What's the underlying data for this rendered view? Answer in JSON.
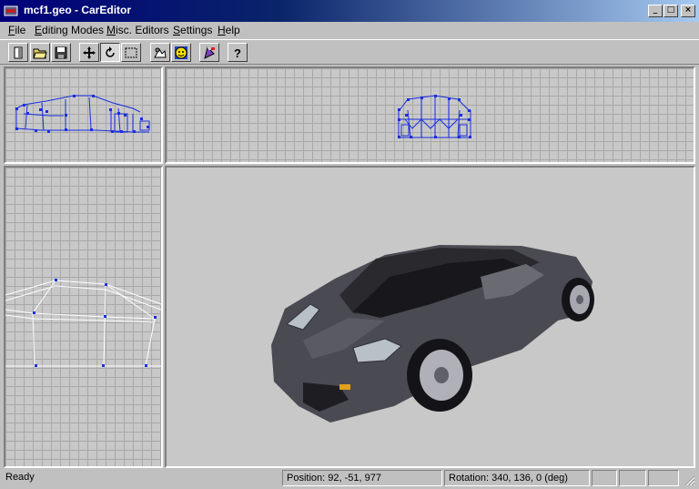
{
  "window": {
    "title": "mcf1.geo - CarEditor",
    "app_icon": "car-editor-icon",
    "controls": [
      "minimize-icon",
      "maximize-icon",
      "close-icon"
    ]
  },
  "menu": [
    {
      "label": "File",
      "accel": "F",
      "rest": "ile"
    },
    {
      "label": "Editing Modes",
      "accel": "E",
      "rest": "diting Modes"
    },
    {
      "label": "Misc. Editors",
      "accel": "M",
      "rest": "isc. Editors"
    },
    {
      "label": "Settings",
      "accel": "S",
      "rest": "ettings"
    },
    {
      "label": "Help",
      "accel": "H",
      "rest": "elp"
    }
  ],
  "toolbar": {
    "buttons": [
      {
        "icon": "new-file-icon"
      },
      {
        "icon": "open-folder-icon"
      },
      {
        "icon": "save-disk-icon"
      },
      {
        "icon": "move-arrows-icon"
      },
      {
        "icon": "rotate-icon",
        "pressed": true
      },
      {
        "icon": "select-rectangle-icon"
      },
      {
        "icon": "texture-editor-icon"
      },
      {
        "icon": "smiley-face-icon"
      },
      {
        "icon": "paint-tool-icon"
      },
      {
        "icon": "help-question-icon"
      }
    ]
  },
  "viewports": {
    "side_view": "wireframe",
    "front_view": "wireframe",
    "top_view": "wireframe",
    "preview": "rendered-3d-car",
    "wire_color": "#1a2ee0",
    "car_color": "#4a4a52"
  },
  "status": {
    "text": "Ready",
    "position": "Position: 92, -51, 977",
    "rotation": "Rotation: 340, 136, 0 (deg)"
  }
}
